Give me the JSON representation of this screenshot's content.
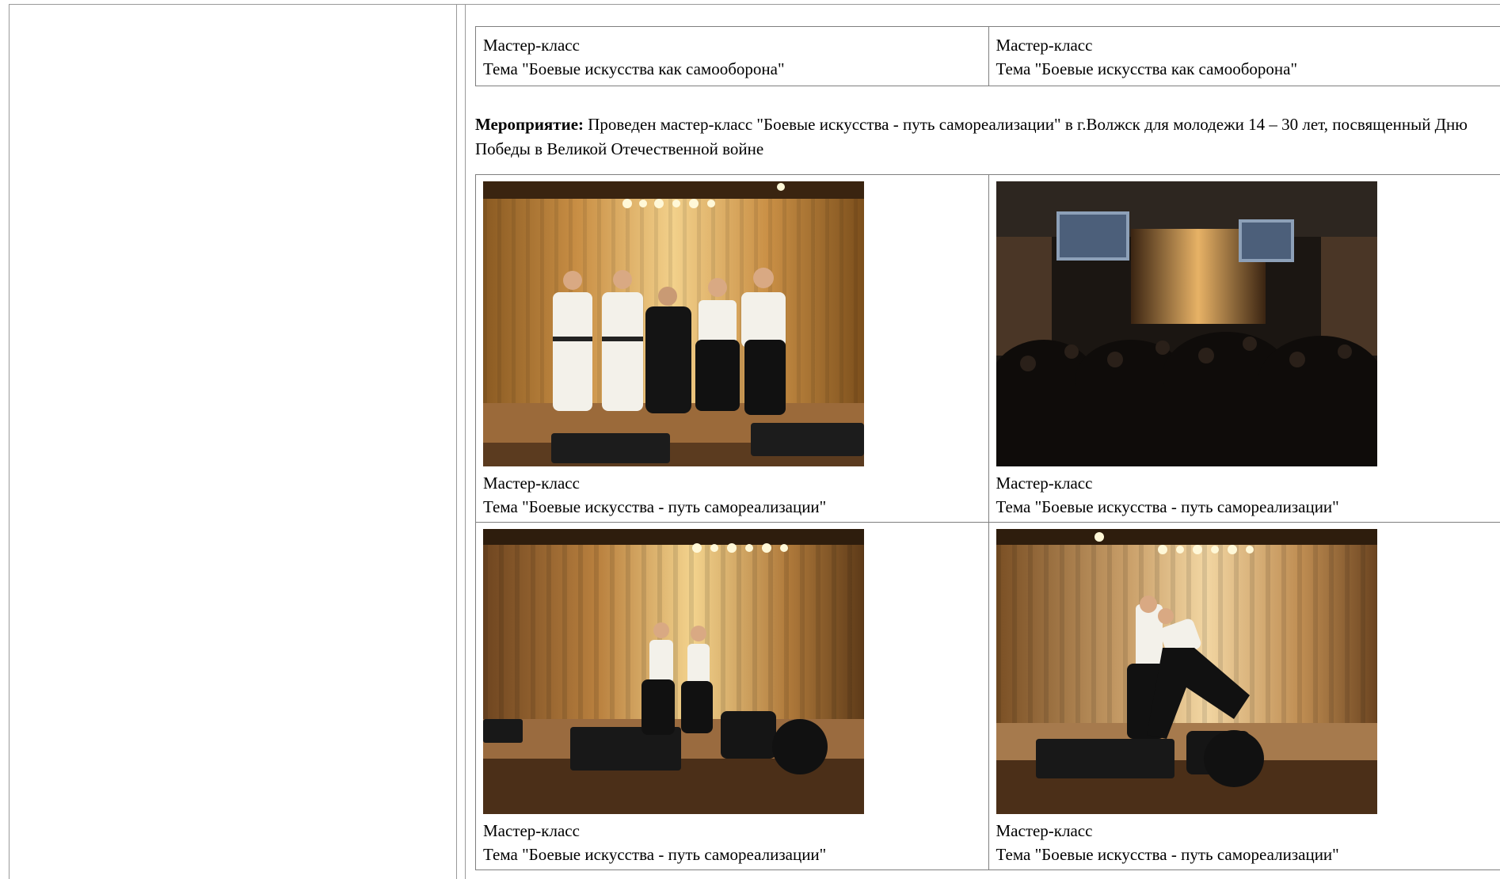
{
  "top_captions": [
    {
      "line1": "Мастер-класс",
      "line2": "Тема \"Боевые искусства как самооборона\""
    },
    {
      "line1": "Мастер-класс",
      "line2": "Тема \"Боевые искусства как самооборона\""
    }
  ],
  "event": {
    "label": "Мероприятие:",
    "text": " Проведен мастер-класс \"Боевые искусства - путь самореализации\" в г.Волжск для молодежи 14 – 30 лет, посвященный Дню Победы в Великой Отечественной войне"
  },
  "photos": [
    {
      "scene": "group-on-stage",
      "line1": "Мастер-класс",
      "line2": "Тема \"Боевые искусства - путь самореализации\""
    },
    {
      "scene": "audience-hall",
      "line1": "Мастер-класс",
      "line2": "Тема \"Боевые искусства - путь самореализации\""
    },
    {
      "scene": "demonstration-pair",
      "line1": "Мастер-класс",
      "line2": "Тема \"Боевые искусства - путь самореализации\""
    },
    {
      "scene": "demonstration-throw",
      "line1": "Мастер-класс",
      "line2": "Тема \"Боевые искусства - путь самореализации\""
    }
  ]
}
